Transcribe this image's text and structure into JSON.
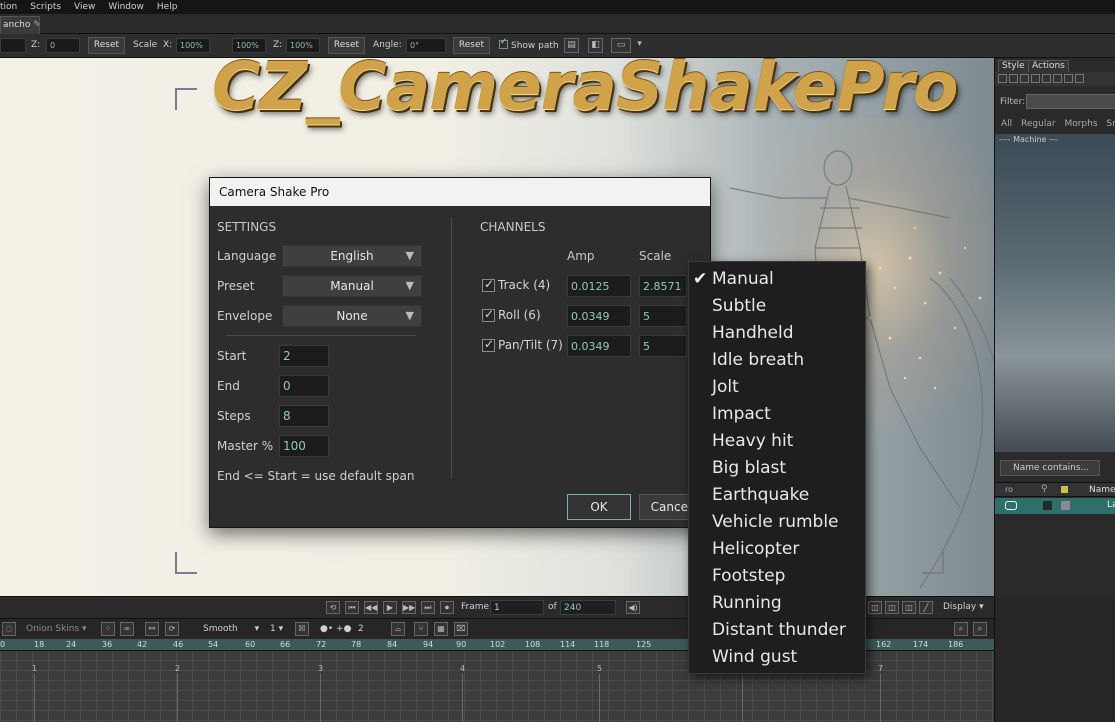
{
  "menubar": {
    "items": [
      "tion",
      "Scripts",
      "View",
      "Window",
      "Help"
    ]
  },
  "document_tab": {
    "label": "ancho"
  },
  "toolbar": {
    "z_label": "Z:",
    "z_value": "0",
    "reset1": "Reset",
    "scale_label": "Scale",
    "x_label": "X:",
    "x_value": "100%",
    "y_value": "100%",
    "zz_label": "Z:",
    "zz_value": "100%",
    "reset2": "Reset",
    "angle_label": "Angle:",
    "angle_value": "0°",
    "reset3": "Reset",
    "show_path": "Show path"
  },
  "banner": {
    "logo_text": "CZ_CameraShakePro"
  },
  "right_panel": {
    "tabs": [
      "Style",
      "Actions"
    ],
    "filter_label": "Filter:",
    "subtabs": [
      "All",
      "Regular",
      "Morphs",
      "Sm"
    ],
    "thumb_caption": "---- Machine ---",
    "name_contains": "Name contains...",
    "name_header": "Name",
    "row_label": "La"
  },
  "transport": {
    "frame_label": "Frame",
    "frame_value": "1",
    "of_label": "of",
    "of_value": "240",
    "display_label": "Display"
  },
  "timeline_tools": {
    "skins": "Onion Skins",
    "smooth": "Smooth",
    "step": "1",
    "step2": "2"
  },
  "ruler": {
    "ticks": [
      "0",
      "18",
      "24",
      "36",
      "42",
      "46",
      "54",
      "60",
      "66",
      "72",
      "78",
      "84",
      "94",
      "90",
      "102",
      "108",
      "114",
      "118",
      "125",
      "162",
      "174",
      "186"
    ]
  },
  "timeline_numbers": [
    "1",
    "2",
    "3",
    "4",
    "5",
    "6",
    "7"
  ],
  "dialog": {
    "title": "Camera Shake Pro",
    "settings": {
      "title": "SETTINGS",
      "language_label": "Language",
      "language_value": "English",
      "preset_label": "Preset",
      "preset_value": "Manual",
      "envelope_label": "Envelope",
      "envelope_value": "None",
      "start_label": "Start",
      "start_value": "2",
      "end_label": "End",
      "end_value": "0",
      "steps_label": "Steps",
      "steps_value": "8",
      "master_label": "Master %",
      "master_value": "100",
      "hint": "End <= Start = use default span"
    },
    "channels": {
      "title": "CHANNELS",
      "amp_header": "Amp",
      "scale_header": "Scale",
      "rows": [
        {
          "name": "Track (4)",
          "amp": "0.0125",
          "scale": "2.8571"
        },
        {
          "name": "Roll (6)",
          "amp": "0.0349",
          "scale": "5"
        },
        {
          "name": "Pan/Tilt (7)",
          "amp": "0.0349",
          "scale": "5"
        }
      ]
    },
    "ok_label": "OK",
    "cancel_label": "Cancel"
  },
  "preset_dropdown": {
    "selected": "Manual",
    "options": [
      "Manual",
      "Subtle",
      "Handheld",
      "Idle breath",
      "Jolt",
      "Impact",
      "Heavy hit",
      "Big blast",
      "Earthquake",
      "Vehicle rumble",
      "Helicopter",
      "Footstep",
      "Running",
      "Distant thunder",
      "Wind gust"
    ]
  },
  "colors": {
    "accent": "#6fb6ad",
    "field_text": "#8fc9c2",
    "logo_gold": "#d0a24a"
  }
}
